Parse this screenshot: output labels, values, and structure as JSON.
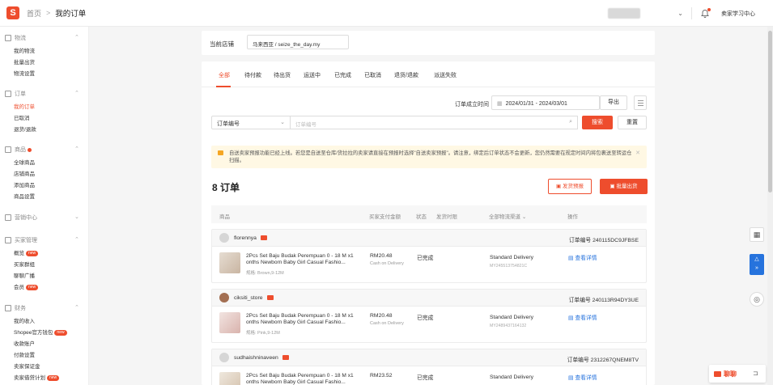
{
  "header": {
    "logo_glyph": "S",
    "breadcrumb_home": "首页",
    "breadcrumb_sep": ">",
    "breadcrumb_current": "我的订单",
    "learning_center": "卖家学习中心"
  },
  "sidebar": {
    "sections": [
      {
        "title": "物流",
        "items": [
          "我的物流",
          "批量出货",
          "物流设置"
        ]
      },
      {
        "title": "订单",
        "items": [
          "我的订单",
          "已取消",
          "退货/退款"
        ],
        "active": "我的订单"
      },
      {
        "title": "商品",
        "items": [
          "全球商品",
          "店铺商品",
          "添加商品",
          "商品设置"
        ]
      },
      {
        "title": "营销中心",
        "items": []
      },
      {
        "title": "买家管理",
        "items": [
          "概览",
          "买家群组",
          "聊聊广播",
          "会员"
        ],
        "badge_text": "new"
      },
      {
        "title": "财务",
        "items": [
          "我的收入",
          "Shopee官方钱包",
          "收款账户",
          "付款设置",
          "卖家保证金",
          "卖家借贷计划"
        ]
      }
    ]
  },
  "shop": {
    "label": "当前店铺",
    "value": "马来西亚 / seize_the_day.my"
  },
  "tabs": [
    "全部",
    "待付款",
    "待出货",
    "运送中",
    "已完成",
    "已取消",
    "退货/退款",
    "派送失败"
  ],
  "filters": {
    "date_label": "订单成立时间",
    "date_range": "2024/01/31 - 2024/03/01",
    "export": "导出",
    "search_type": "订单编号",
    "search_placeholder": "订单编号",
    "search_button": "搜索",
    "reset_button": "重置"
  },
  "notice": "自送卖家预报功能已经上线。若您是自送至仓库/货拉拉的卖家请直接在预报时选择\"自送卖家预报\"。请注意，绑定后订单状态不会更新，您仍然需要在规定时间内将包裹送至转运仓扫描。",
  "orders_summary": {
    "count_label": "8 订单",
    "pre_ship_button": "发货预报",
    "bulk_ship_button": "批量出货"
  },
  "table_headers": {
    "product": "商品",
    "paid": "买家支付金额",
    "status": "状态",
    "countdown": "发货时限",
    "channel": "全部物流渠道",
    "actions": "操作"
  },
  "orders": [
    {
      "buyer": "florennya",
      "order_no": "订单编号 240115DC9JFBSE",
      "product": "2Pcs Set Baju Budak Perempuan 0 - 18 M x1 onths Newborn Baby Girl Casual Fashio...",
      "variant": "规格: Brown,9-12M",
      "price": "RM20.48",
      "payment": "Cash on Delivery",
      "status": "已完成",
      "channel": "Standard Delivery",
      "tracking": "MY245513754821C",
      "action": "查看详情"
    },
    {
      "buyer": "ciksiti_store",
      "order_no": "订单编号 240113R94DY3UE",
      "product": "2Pcs Set Baju Budak Perempuan 0 - 18 M x1 onths Newborn Baby Girl Casual Fashio...",
      "variant": "规格: Pink,9-12M",
      "price": "RM20.48",
      "payment": "Cash on Delivery",
      "status": "已完成",
      "channel": "Standard Delivery",
      "tracking": "MY2489437164132",
      "action": "查看详情"
    },
    {
      "buyer": "sudhaishninaveen",
      "order_no": "订单编号 2312267QNEM8TV",
      "product": "2Pcs Set Baju Budak Perempuan 0 - 18 M x1 onths Newborn Baby Girl Casual Fashio...",
      "variant": "",
      "price": "RM23.52",
      "payment": "",
      "status": "已完成",
      "channel": "Standard Delivery",
      "tracking": "",
      "action": "查看详情"
    }
  ],
  "chat_widget": {
    "label": "聊聊"
  },
  "colors": {
    "brand": "#ee4d2d",
    "link": "#2673dd"
  }
}
